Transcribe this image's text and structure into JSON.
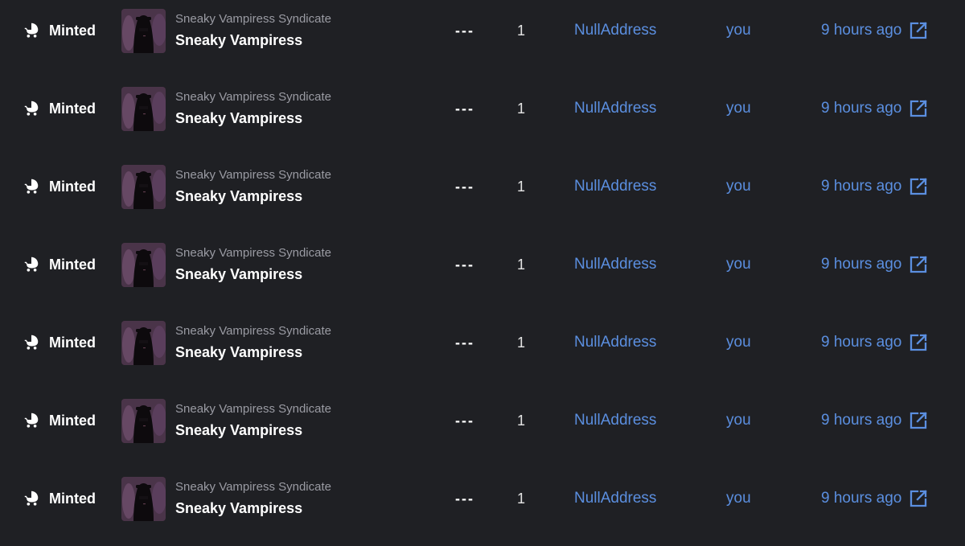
{
  "rows": [
    {
      "event": "Minted",
      "event_icon": "baby-carriage-icon",
      "collection": "Sneaky Vampiress Syndicate",
      "item": "Sneaky Vampiress",
      "price": "---",
      "quantity": "1",
      "from": "NullAddress",
      "to": "you",
      "time": "9 hours ago",
      "link_icon": "external-link-icon"
    },
    {
      "event": "Minted",
      "event_icon": "baby-carriage-icon",
      "collection": "Sneaky Vampiress Syndicate",
      "item": "Sneaky Vampiress",
      "price": "---",
      "quantity": "1",
      "from": "NullAddress",
      "to": "you",
      "time": "9 hours ago",
      "link_icon": "external-link-icon"
    },
    {
      "event": "Minted",
      "event_icon": "baby-carriage-icon",
      "collection": "Sneaky Vampiress Syndicate",
      "item": "Sneaky Vampiress",
      "price": "---",
      "quantity": "1",
      "from": "NullAddress",
      "to": "you",
      "time": "9 hours ago",
      "link_icon": "external-link-icon"
    },
    {
      "event": "Minted",
      "event_icon": "baby-carriage-icon",
      "collection": "Sneaky Vampiress Syndicate",
      "item": "Sneaky Vampiress",
      "price": "---",
      "quantity": "1",
      "from": "NullAddress",
      "to": "you",
      "time": "9 hours ago",
      "link_icon": "external-link-icon"
    },
    {
      "event": "Minted",
      "event_icon": "baby-carriage-icon",
      "collection": "Sneaky Vampiress Syndicate",
      "item": "Sneaky Vampiress",
      "price": "---",
      "quantity": "1",
      "from": "NullAddress",
      "to": "you",
      "time": "9 hours ago",
      "link_icon": "external-link-icon"
    },
    {
      "event": "Minted",
      "event_icon": "baby-carriage-icon",
      "collection": "Sneaky Vampiress Syndicate",
      "item": "Sneaky Vampiress",
      "price": "---",
      "quantity": "1",
      "from": "NullAddress",
      "to": "you",
      "time": "9 hours ago",
      "link_icon": "external-link-icon"
    },
    {
      "event": "Minted",
      "event_icon": "baby-carriage-icon",
      "collection": "Sneaky Vampiress Syndicate",
      "item": "Sneaky Vampiress",
      "price": "---",
      "quantity": "1",
      "from": "NullAddress",
      "to": "you",
      "time": "9 hours ago",
      "link_icon": "external-link-icon"
    }
  ],
  "colors": {
    "background": "#1f2024",
    "text_primary": "#ffffff",
    "text_secondary": "#9a9ba3",
    "link": "#5b8fe0"
  }
}
